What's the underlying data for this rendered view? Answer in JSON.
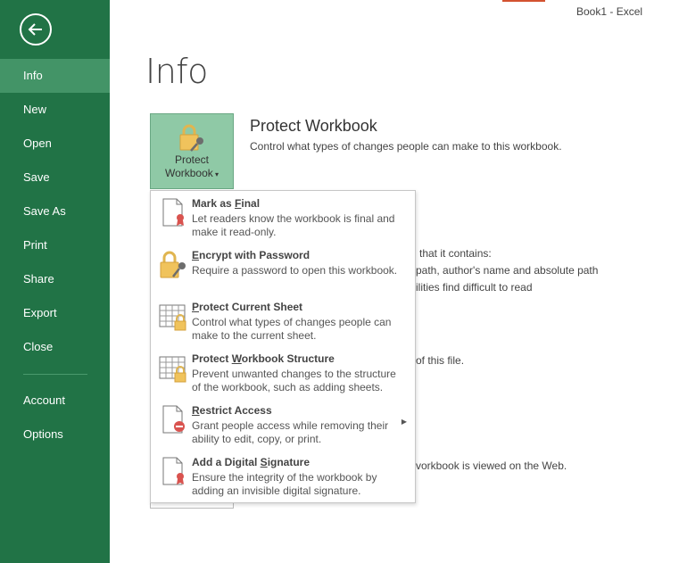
{
  "window": {
    "title": "Book1 - Excel"
  },
  "sidebar": {
    "items": [
      {
        "label": "Info"
      },
      {
        "label": "New"
      },
      {
        "label": "Open"
      },
      {
        "label": "Save"
      },
      {
        "label": "Save As"
      },
      {
        "label": "Print"
      },
      {
        "label": "Share"
      },
      {
        "label": "Export"
      },
      {
        "label": "Close"
      },
      {
        "label": "Account"
      },
      {
        "label": "Options"
      }
    ]
  },
  "page": {
    "title": "Info"
  },
  "protect": {
    "button_line1": "Protect",
    "button_line2": "Workbook",
    "title": "Protect Workbook",
    "description": "Control what types of changes people can make to this workbook."
  },
  "background_text": {
    "inspect_line1": "that it contains:",
    "inspect_line2": "path, author's name and absolute path",
    "inspect_line3": "ilities find difficult to read",
    "versions_line": "of this file.",
    "browser_line": "vorkbook is viewed on the Web."
  },
  "menu": {
    "items": [
      {
        "title_pre": "Mark as ",
        "title_key": "F",
        "title_post": "inal",
        "description": "Let readers know the workbook is final and make it read-only.",
        "icon": "mark-final-icon"
      },
      {
        "title_pre": "",
        "title_key": "E",
        "title_post": "ncrypt with Password",
        "description": "Require a password to open this workbook.",
        "icon": "encrypt-password-icon"
      },
      {
        "title_pre": "",
        "title_key": "P",
        "title_post": "rotect Current Sheet",
        "description": "Control what types of changes people can make to the current sheet.",
        "icon": "protect-sheet-icon"
      },
      {
        "title_pre": "Protect ",
        "title_key": "W",
        "title_post": "orkbook Structure",
        "description": "Prevent unwanted changes to the structure of the workbook, such as adding sheets.",
        "icon": "protect-structure-icon"
      },
      {
        "title_pre": "",
        "title_key": "R",
        "title_post": "estrict Access",
        "description": "Grant people access while removing their ability to edit, copy, or print.",
        "icon": "restrict-access-icon"
      },
      {
        "title_pre": "Add a Digital ",
        "title_key": "S",
        "title_post": "ignature",
        "description": "Ensure the integrity of the workbook by adding an invisible digital signature.",
        "icon": "digital-signature-icon"
      }
    ]
  },
  "colors": {
    "sidebar": "#217346",
    "sidebar_active": "#439467",
    "protect_button": "#8fc9a6",
    "accent": "#d35230"
  }
}
